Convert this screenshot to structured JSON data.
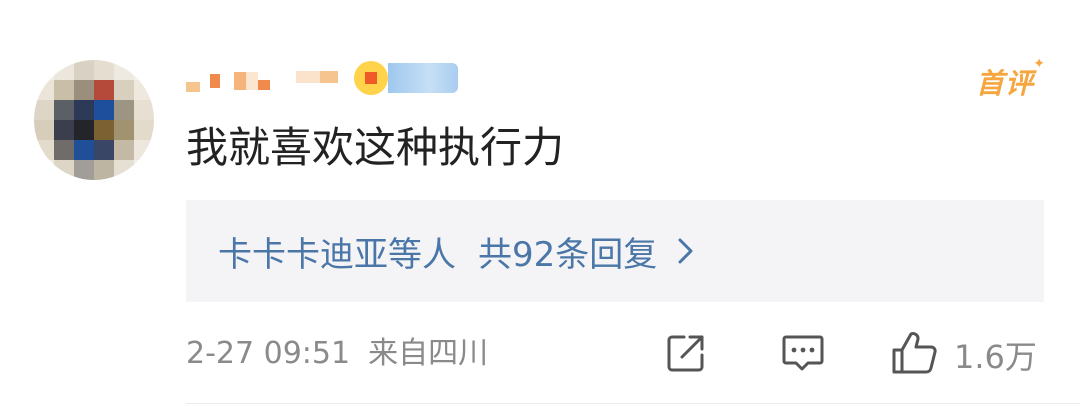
{
  "comment": {
    "first_comment_tag": "首评",
    "text": "我就喜欢这种执行力",
    "replies": {
      "names": "卡卡卡迪亚等人",
      "total": "共92条回复"
    },
    "timestamp": "2-27 09:51",
    "location": "来自四川",
    "likes": "1.6万"
  },
  "colors": {
    "link": "#4a76a8",
    "tag": "#f6a53f",
    "meta": "#8a8a8a",
    "reply_bg": "#f4f4f6"
  },
  "icons": {
    "share": "share-icon",
    "comment": "comment-icon",
    "like": "thumbs-up-icon",
    "chevron": "chevron-right-icon"
  }
}
